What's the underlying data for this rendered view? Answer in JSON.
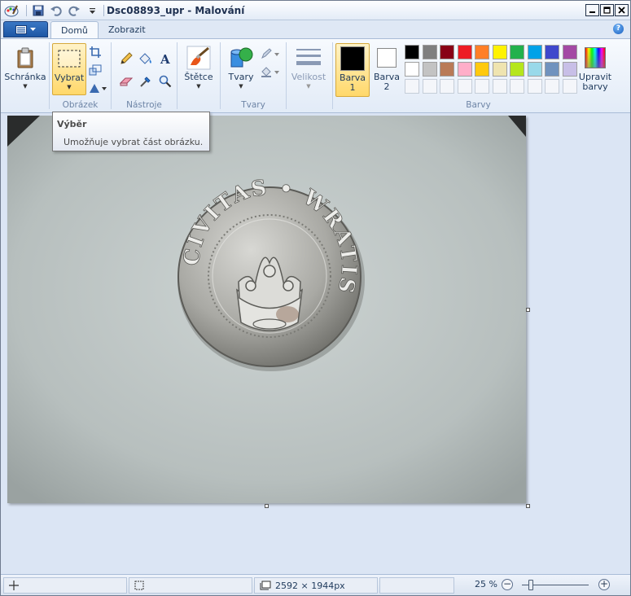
{
  "window": {
    "title": "Dsc08893_upr - Malování"
  },
  "tabs": [
    {
      "label": "Domů"
    },
    {
      "label": "Zobrazit"
    }
  ],
  "help": {
    "glyph": "?"
  },
  "ribbon": {
    "clipboard": {
      "button_label": "Schránka"
    },
    "image": {
      "group_label": "Obrázek",
      "select_label": "Vybrat"
    },
    "tools": {
      "group_label": "Nástroje"
    },
    "brushes": {
      "label": "Štětce"
    },
    "shapes": {
      "group_label": "Tvary",
      "shapes_label": "Tvary"
    },
    "size": {
      "label": "Velikost"
    },
    "colors": {
      "group_label": "Barvy",
      "color1_label": "Barva",
      "color1_num": "1",
      "color2_label": "Barva",
      "color2_num": "2",
      "edit_colors_line1": "Upravit",
      "edit_colors_line2": "barvy",
      "color1": "#000000",
      "color2": "#ffffff",
      "palette_row1": [
        "#000000",
        "#7f7f7f",
        "#880015",
        "#ed1c24",
        "#ff7f27",
        "#fff200",
        "#22b14c",
        "#00a2e8",
        "#3f48cc",
        "#a349a4"
      ],
      "palette_row2": [
        "#ffffff",
        "#c3c3c3",
        "#b97a57",
        "#ffaec9",
        "#ffc90e",
        "#efe4b0",
        "#b5e61d",
        "#99d9ea",
        "#7092be",
        "#c8bfe7"
      ]
    }
  },
  "tooltip": {
    "title": "Výběr",
    "description": "Umožňuje vybrat část obrázku."
  },
  "coin": {
    "legend": "CIVITAS • WRATIS"
  },
  "status": {
    "dimensions": "2592 × 1944px",
    "zoom": "25 %"
  }
}
